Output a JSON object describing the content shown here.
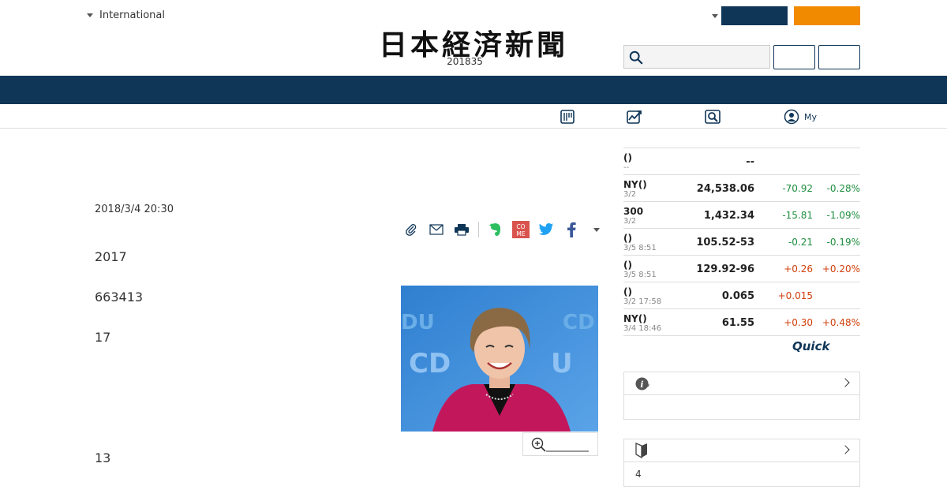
{
  "header": {
    "edition_label": "International",
    "logo_text": "日本経済新聞",
    "date": "201835",
    "search_placeholder": ""
  },
  "subnav": {
    "my_label": "My"
  },
  "article": {
    "date": "2018/3/4 20:30",
    "paragraphs": [
      "2017",
      "663413",
      "17",
      "13"
    ]
  },
  "market": {
    "rows": [
      {
        "name": "()",
        "time": "--",
        "value": "--",
        "change": "",
        "percent": "",
        "dir": ""
      },
      {
        "name": "NY()",
        "time": "3/2",
        "value": "24,538.06",
        "change": "-70.92",
        "percent": "-0.28%",
        "dir": "down"
      },
      {
        "name": "300",
        "time": "3/2",
        "value": "1,432.34",
        "change": "-15.81",
        "percent": "-1.09%",
        "dir": "down"
      },
      {
        "name": "()",
        "time": "3/5 8:51",
        "value": "105.52-53",
        "change": "-0.21",
        "percent": "-0.19%",
        "dir": "down"
      },
      {
        "name": "()",
        "time": "3/5 8:51",
        "value": "129.92-96",
        "change": "+0.26",
        "percent": "+0.20%",
        "dir": "up"
      },
      {
        "name": "()",
        "time": "3/2 17:58",
        "value": "0.065",
        "change": "+0.015",
        "percent": "",
        "dir": "up"
      },
      {
        "name": "NY()",
        "time": "3/4 18:46",
        "value": "61.55",
        "change": "+0.30",
        "percent": "+0.48%",
        "dir": "up"
      }
    ],
    "provider": "Quick"
  },
  "panels": {
    "panel2_body": "4"
  },
  "colors": {
    "navy": "#0f3557",
    "orange": "#f28a00",
    "down": "#1e8e3e",
    "up": "#d0400c"
  }
}
